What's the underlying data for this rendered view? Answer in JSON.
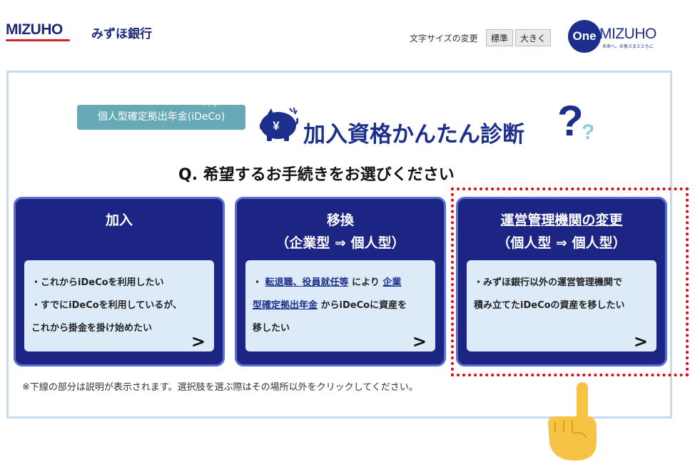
{
  "header": {
    "brand_mizuho": "MIZUHO",
    "brand_bank": "みずほ銀行",
    "font_size_label": "文字サイズの変更",
    "font_size_standard": "標準",
    "font_size_large": "大きく",
    "one_logo_one": "One",
    "one_logo_mizuho": "MIZUHO",
    "one_logo_tagline": "未来へ。お客さまとともに"
  },
  "hero": {
    "pill_text": "個人型確定拠出年金(iDeCo)",
    "pill_ruby": "イデコ",
    "title": "加入資格かんたん診断"
  },
  "question": "Q.  希望するお手続きをお選びください",
  "cards": [
    {
      "title_line1": "加入",
      "title_line2": "",
      "lines": [
        "・これからiDeCoを利用したい",
        "・すでにiDeCoを利用しているが、",
        "これから掛金を掛け始めたい"
      ],
      "chevron": ">"
    },
    {
      "title_line1": "移換",
      "title_line2": "（企業型 ⇒ 個人型）",
      "link1": "転退職、役員就任等",
      "text_mid": " により ",
      "link2a": "企業",
      "link2b": "型確定拠出年金",
      "text_end": " からiDeCoに資産を",
      "text_last": "移したい",
      "bullet": "・ ",
      "chevron": ">"
    },
    {
      "title_line1": "運営管理機関の変更",
      "title_line2": "（個人型 ⇒ 個人型）",
      "lines": [
        "・みずほ銀行以外の運営管理機関で",
        "積み立てたiDeCoの資産を移したい"
      ],
      "chevron": ">"
    }
  ],
  "note": "※下線の部分は説明が表示されます。選択肢を選ぶ際はその場所以外をクリックしてください。",
  "colors": {
    "card_bg": "#1c2484",
    "card_border": "#5a6fd6",
    "card_inner": "#ddebf8",
    "highlight": "#e60012",
    "frame": "#c8dcf1",
    "pill": "#67a9b6"
  }
}
